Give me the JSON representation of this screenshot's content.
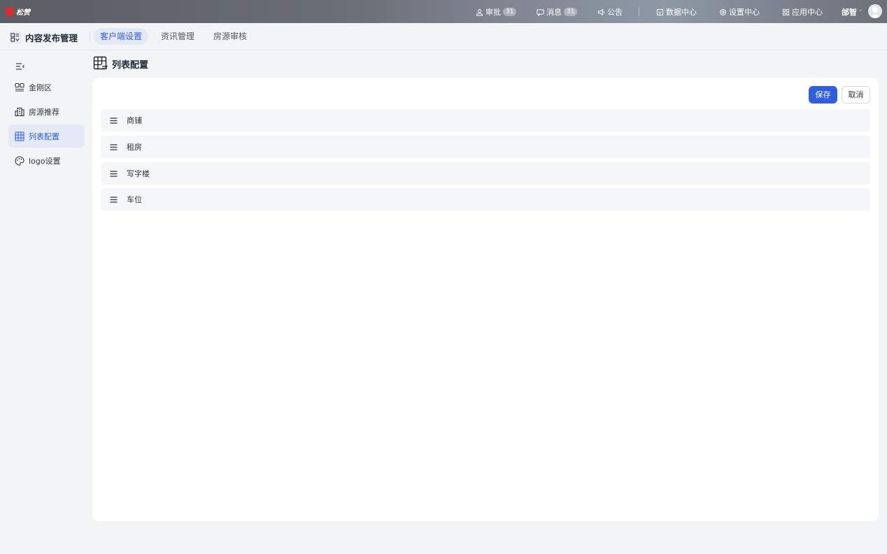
{
  "brand": {
    "name": "松赞",
    "color": "#d32f2f"
  },
  "topbar": {
    "items": [
      {
        "label": "审批",
        "icon": "user-icon",
        "badge": "31"
      },
      {
        "label": "消息",
        "icon": "message-icon",
        "badge": "31"
      },
      {
        "label": "公告",
        "icon": "megaphone-icon"
      },
      {
        "label": "数据中心",
        "icon": "data-icon"
      },
      {
        "label": "设置中心",
        "icon": "gear-icon"
      },
      {
        "label": "应用中心",
        "icon": "apps-icon"
      }
    ],
    "user": {
      "name": "邰智",
      "caret": "⌄"
    }
  },
  "subheader": {
    "app_title": "内容发布管理",
    "tabs": [
      {
        "label": "客户端设置",
        "active": true
      },
      {
        "label": "资讯管理",
        "active": false
      },
      {
        "label": "房源审核",
        "active": false
      }
    ]
  },
  "sidebar": {
    "items": [
      {
        "label": "金刚区",
        "icon": "grid-icon"
      },
      {
        "label": "房源推荐",
        "icon": "building-icon"
      },
      {
        "label": "列表配置",
        "icon": "table-icon",
        "active": true
      },
      {
        "label": "logo设置",
        "icon": "palette-icon"
      }
    ]
  },
  "main": {
    "title": "列表配置",
    "buttons": {
      "save": "保存",
      "cancel": "取消"
    },
    "rows": [
      "商铺",
      "租房",
      "写字楼",
      "车位"
    ]
  },
  "colors": {
    "accent": "#2f5fdc",
    "accent_bg": "#e3e8f9"
  }
}
